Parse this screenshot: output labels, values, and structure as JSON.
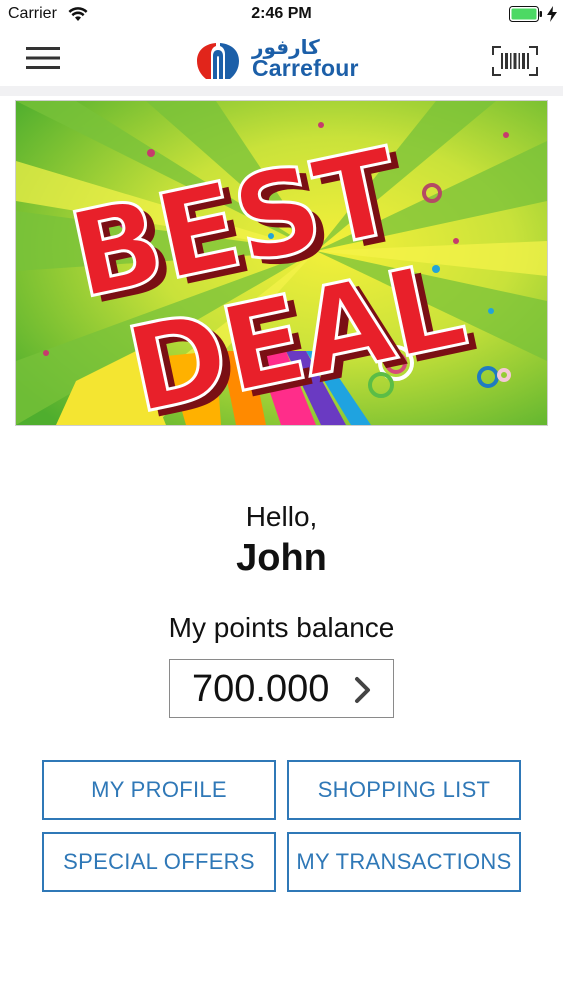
{
  "status_bar": {
    "carrier": "Carrier",
    "time": "2:46 PM",
    "icons": [
      "wifi-icon",
      "battery-icon",
      "charging-icon"
    ]
  },
  "nav_bar": {
    "menu_icon": "menu-icon",
    "logo_arabic": "كارفور",
    "logo_text": "Carrefour",
    "barcode_icon": "barcode-icon"
  },
  "banner": {
    "line1": "BEST",
    "line2": "DEAL"
  },
  "greeting": {
    "hello": "Hello,",
    "name": "John"
  },
  "points": {
    "label": "My points balance",
    "value": "700.000"
  },
  "actions": {
    "my_profile": "MY PROFILE",
    "shopping_list": "SHOPPING LIST",
    "special_offers": "SPECIAL OFFERS",
    "my_transactions": "MY TRANSACTIONS"
  },
  "colors": {
    "brand_blue": "#1c5fa8",
    "button_blue": "#2f78b7",
    "brand_red": "#e1251b",
    "banner_red": "#e8202a",
    "battery_green": "#4cd964"
  }
}
